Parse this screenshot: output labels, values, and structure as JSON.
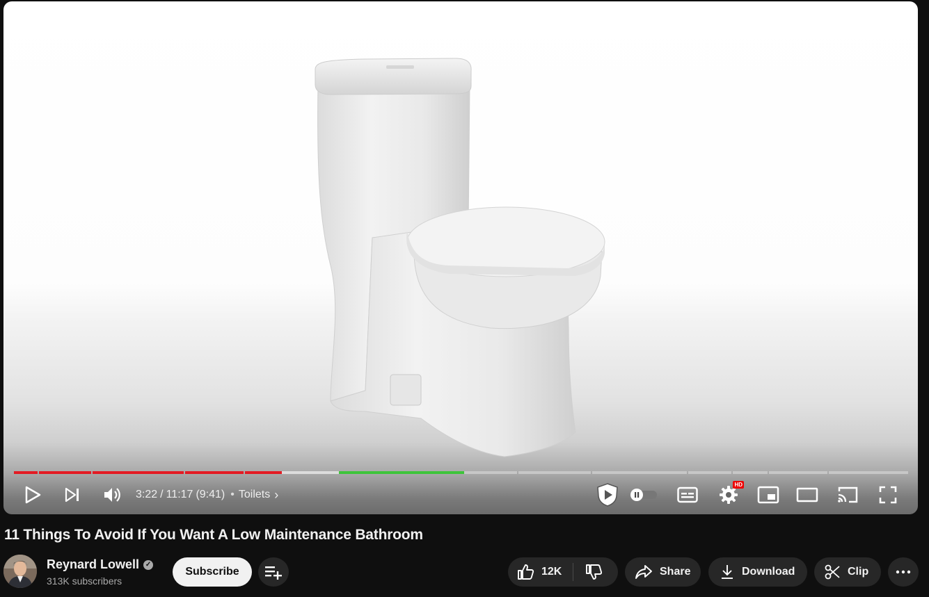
{
  "player": {
    "current_time": "3:22",
    "duration": "11:17",
    "time_separator": "/",
    "remaining": "(9:41)",
    "chapter_bullet": "•",
    "chapter": "Toilets",
    "chapter_chevron": "›",
    "hd_badge": "HD",
    "progress_fraction": 0.298,
    "icons": {
      "play": "play-icon",
      "next": "next-icon",
      "volume": "volume-icon",
      "sponsor": "shield-play-icon",
      "autoplay": "autoplay-toggle-icon",
      "subtitles": "subtitles-icon",
      "settings": "gear-icon",
      "miniplayer": "miniplayer-icon",
      "theater": "theater-mode-icon",
      "cast": "cast-icon",
      "fullscreen": "fullscreen-icon"
    }
  },
  "video": {
    "title": "11 Things To Avoid If You Want A Low Maintenance Bathroom"
  },
  "channel": {
    "name": "Reynard Lowell",
    "verified_glyph": "✓",
    "subscribers": "313K subscribers",
    "subscribe_label": "Subscribe"
  },
  "actions": {
    "like_count": "12K",
    "share_label": "Share",
    "download_label": "Download",
    "clip_label": "Clip"
  },
  "colors": {
    "background": "#0f0f0f",
    "progress_played": "#e31b23",
    "progress_segment_highlight": "#3ec43a",
    "button_bg": "#272727",
    "subscribe_bg": "#f1f1f1"
  }
}
